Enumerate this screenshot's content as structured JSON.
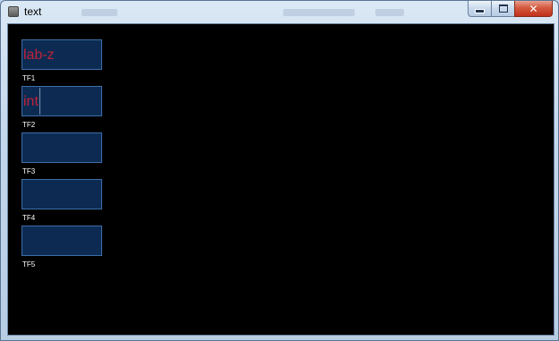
{
  "window": {
    "title": "text",
    "controls": {
      "minimize_icon": "minimize-icon",
      "maximize_icon": "maximize-icon",
      "close_icon": "close-icon",
      "close_glyph": "✕"
    }
  },
  "colors": {
    "client_background": "#000000",
    "field_fill": "#0d2b52",
    "field_border": "#3c6fa8",
    "field_text": "#c0223c",
    "label_text": "#ffffff"
  },
  "fields": [
    {
      "id": "tf1",
      "value": "lab-z",
      "label": "TF1"
    },
    {
      "id": "tf2",
      "value": "int",
      "label": "TF2"
    },
    {
      "id": "tf3",
      "value": "",
      "label": "TF3"
    },
    {
      "id": "tf4",
      "value": "",
      "label": "TF4"
    },
    {
      "id": "tf5",
      "value": "",
      "label": "TF5"
    }
  ]
}
